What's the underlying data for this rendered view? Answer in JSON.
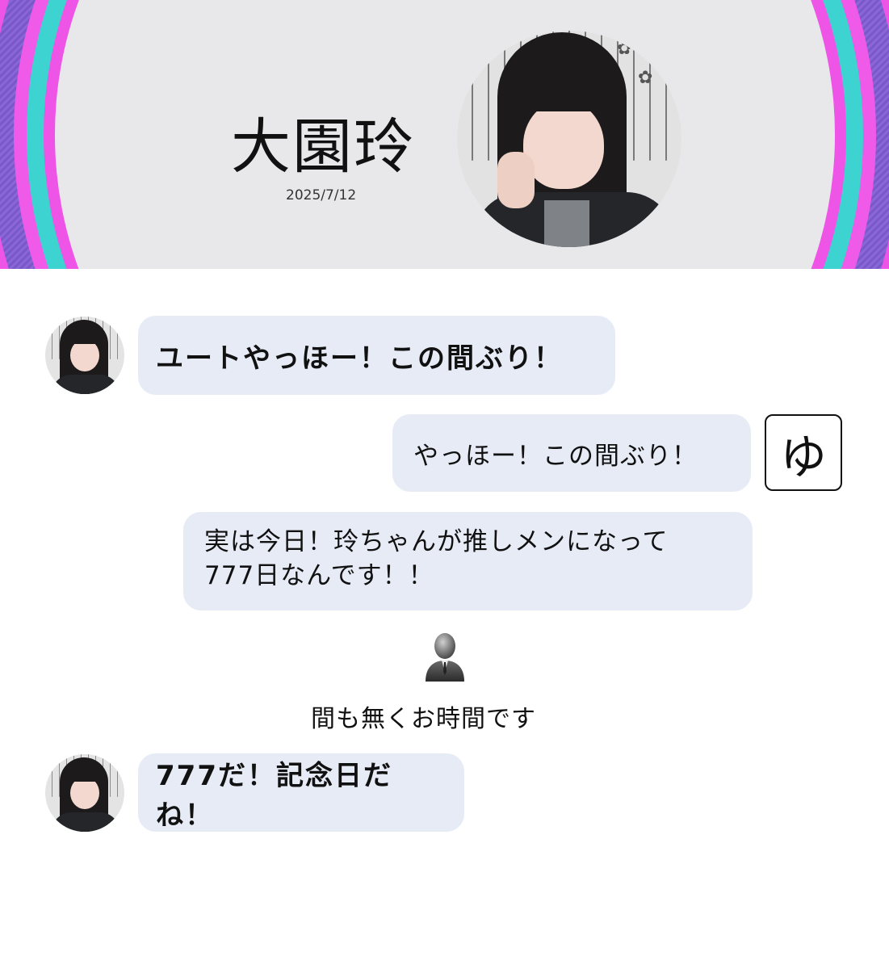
{
  "header": {
    "name": "大園玲",
    "date": "2025/7/12"
  },
  "messages": [
    {
      "from": "member",
      "text": "ユートやっほー！この間ぶり！"
    },
    {
      "from": "user",
      "text": "やっほー！この間ぶり！",
      "icon_label": "ゆ"
    },
    {
      "from": "user",
      "lines": [
        "実は今日！玲ちゃんが推しメンになって",
        "777日なんです！！"
      ]
    },
    {
      "from": "staff",
      "text": "間も無くお時間です",
      "icon": "staff-person-icon"
    },
    {
      "from": "member",
      "text": "777だ！記念日だね！"
    }
  ],
  "colors": {
    "bubble": "#e6ebf6",
    "ring_pink": "#ee55e6",
    "ring_teal": "#3cd3d0",
    "banner_inner": "#e8e8ea"
  }
}
